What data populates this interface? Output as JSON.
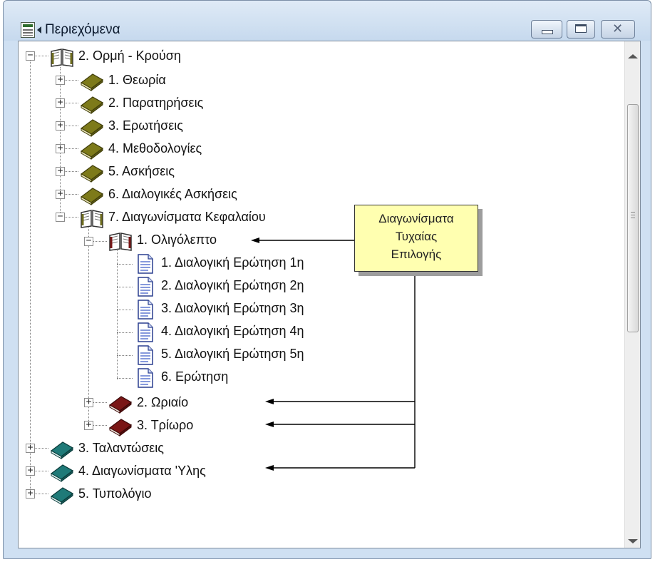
{
  "window": {
    "title": "Περιεχόμενα"
  },
  "tree": {
    "root_label": "2. Ορμή - Κρούση",
    "items": [
      {
        "label": "1. Θεωρία",
        "icon": "book-olive-closed-icon"
      },
      {
        "label": "2. Παρατηρήσεις",
        "icon": "book-olive-closed-icon"
      },
      {
        "label": "3. Ερωτήσεις",
        "icon": "book-olive-closed-icon"
      },
      {
        "label": "4. Μεθοδολογίες",
        "icon": "book-olive-closed-icon"
      },
      {
        "label": "5. Ασκήσεις",
        "icon": "book-olive-closed-icon"
      },
      {
        "label": "6. Διαλογικές Ασκήσεις",
        "icon": "book-olive-closed-icon"
      },
      {
        "label": "7. Διαγωνίσματα Κεφαλαίου",
        "icon": "book-open-icon"
      }
    ],
    "sub": {
      "oligolepto": "1. Ολιγόλεπτο",
      "documents": [
        "1. Διαλογική Ερώτηση 1η",
        "2. Διαλογική Ερώτηση 2η",
        "3. Διαλογική Ερώτηση 3η",
        "4. Διαλογική Ερώτηση 4η",
        "5. Διαλογική Ερώτηση 5η",
        "6. Ερώτηση"
      ],
      "oriaio": "2. Ωριαίο",
      "triworo": "3. Τρίωρο"
    },
    "top_items": [
      "3. Ταλαντώσεις",
      "4. Διαγωνίσματα 'Υλης",
      "5. Τυπολόγιο"
    ]
  },
  "callout": {
    "line1": "Διαγωνίσματα",
    "line2": "Τυχαίας",
    "line3": "Επιλογής"
  },
  "colors": {
    "book_olive": "#7d7a1a",
    "book_red": "#7a1616",
    "book_teal": "#1f7a78",
    "callout_bg": "#ffffb0",
    "window_frame": "#cfe0f2"
  }
}
